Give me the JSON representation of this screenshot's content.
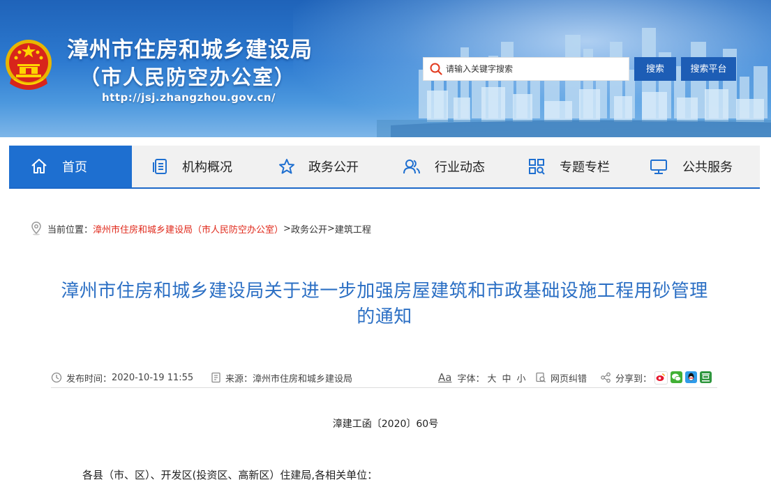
{
  "header": {
    "title": "漳州市住房和城乡建设局",
    "subtitle": "（市人民防空办公室）",
    "url": "http://jsj.zhangzhou.gov.cn/",
    "search_placeholder": "请输入关键字搜索",
    "search_button": "搜索",
    "platform_button": "搜索平台"
  },
  "nav": {
    "items": [
      {
        "label": "首页",
        "icon": "home-icon",
        "active": true
      },
      {
        "label": "机构概况",
        "icon": "document-list-icon"
      },
      {
        "label": "政务公开",
        "icon": "star-icon"
      },
      {
        "label": "行业动态",
        "icon": "users-icon"
      },
      {
        "label": "专题专栏",
        "icon": "grid-search-icon"
      },
      {
        "label": "公共服务",
        "icon": "monitor-icon"
      }
    ]
  },
  "breadcrumb": {
    "prefix": "当前位置：",
    "home": "漳州市住房和城乡建设局（市人民防空办公室）",
    "sep1": ">",
    "level1": "政务公开",
    "sep2": ">",
    "level2": "建筑工程"
  },
  "article": {
    "title": "漳州市住房和城乡建设局关于进一步加强房屋建筑和市政基础设施工程用砂管理的通知",
    "publish_label": "发布时间：",
    "publish_time": "2020-10-19 11:55",
    "source_label": "来源：",
    "source": "漳州市住房和城乡建设局",
    "font_label": "字体：",
    "font_sizes": [
      "大",
      "中",
      "小"
    ],
    "error_link": "网页纠错",
    "share_label": "分享到：",
    "doc_number": "漳建工函〔2020〕60号",
    "salutation": "各县（市、区）、开发区(投资区、高新区）住建局,各相关单位："
  },
  "colors": {
    "brand_blue": "#1e6fd0",
    "title_blue": "#2b6fc4",
    "crumb_red": "#e0291b"
  }
}
